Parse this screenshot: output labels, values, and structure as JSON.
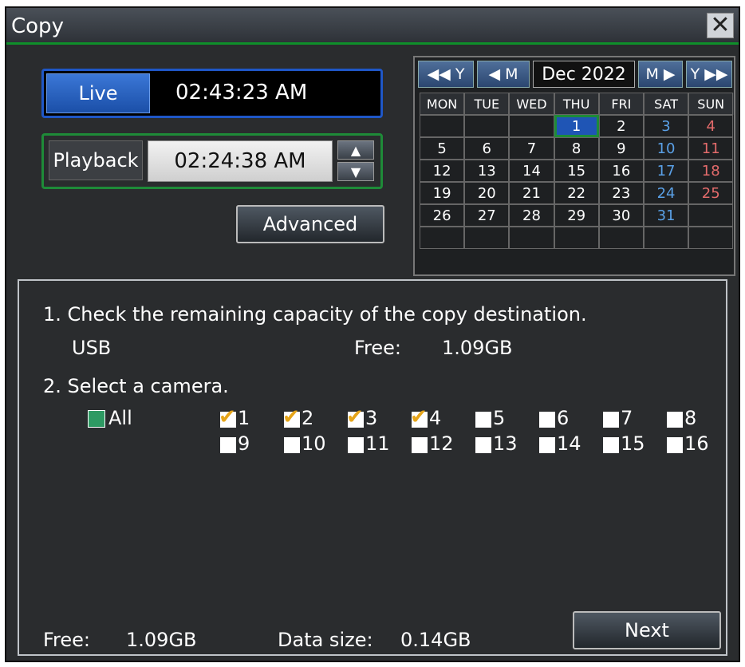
{
  "window": {
    "title": "Copy",
    "close_label": "✕"
  },
  "live": {
    "button_label": "Live",
    "time": "02:43:23 AM"
  },
  "playback": {
    "label": "Playback",
    "time": "02:24:38 AM",
    "up": "▲",
    "down": "▼"
  },
  "advanced_label": "Advanced",
  "calendar": {
    "prev_year": "◀◀ Y",
    "prev_month": "◀ M",
    "month_label": "Dec 2022",
    "next_month": "M ▶",
    "next_year": "Y ▶▶",
    "weekdays": [
      "MON",
      "TUE",
      "WED",
      "THU",
      "FRI",
      "SAT",
      "SUN"
    ],
    "weeks": [
      [
        "",
        "",
        "",
        "1",
        "2",
        "3",
        "4"
      ],
      [
        "5",
        "6",
        "7",
        "8",
        "9",
        "10",
        "11"
      ],
      [
        "12",
        "13",
        "14",
        "15",
        "16",
        "17",
        "18"
      ],
      [
        "19",
        "20",
        "21",
        "22",
        "23",
        "24",
        "25"
      ],
      [
        "26",
        "27",
        "28",
        "29",
        "30",
        "31",
        ""
      ],
      [
        "",
        "",
        "",
        "",
        "",
        "",
        ""
      ]
    ],
    "selected_day": "1"
  },
  "panel": {
    "step1": "1. Check the remaining capacity of the copy destination.",
    "device": "USB",
    "free_label": "Free:",
    "free_value": "1.09GB",
    "step2": "2. Select a camera.",
    "all_label": "All",
    "cameras": [
      {
        "label": "1",
        "checked": true
      },
      {
        "label": "2",
        "checked": true
      },
      {
        "label": "3",
        "checked": true
      },
      {
        "label": "4",
        "checked": true
      },
      {
        "label": "5",
        "checked": false
      },
      {
        "label": "6",
        "checked": false
      },
      {
        "label": "7",
        "checked": false
      },
      {
        "label": "8",
        "checked": false
      },
      {
        "label": "9",
        "checked": false
      },
      {
        "label": "10",
        "checked": false
      },
      {
        "label": "11",
        "checked": false
      },
      {
        "label": "12",
        "checked": false
      },
      {
        "label": "13",
        "checked": false
      },
      {
        "label": "14",
        "checked": false
      },
      {
        "label": "15",
        "checked": false
      },
      {
        "label": "16",
        "checked": false
      }
    ],
    "footer_free_label": "Free:",
    "footer_free_value": "1.09GB",
    "data_size_label": "Data size:",
    "data_size_value": "0.14GB",
    "next_label": "Next"
  },
  "colors": {
    "accent_blue": "#1f57c7",
    "accent_green": "#1e8b38",
    "check": "#e6a51a",
    "saturday": "#5aa0e6",
    "sunday": "#e36b6b"
  }
}
